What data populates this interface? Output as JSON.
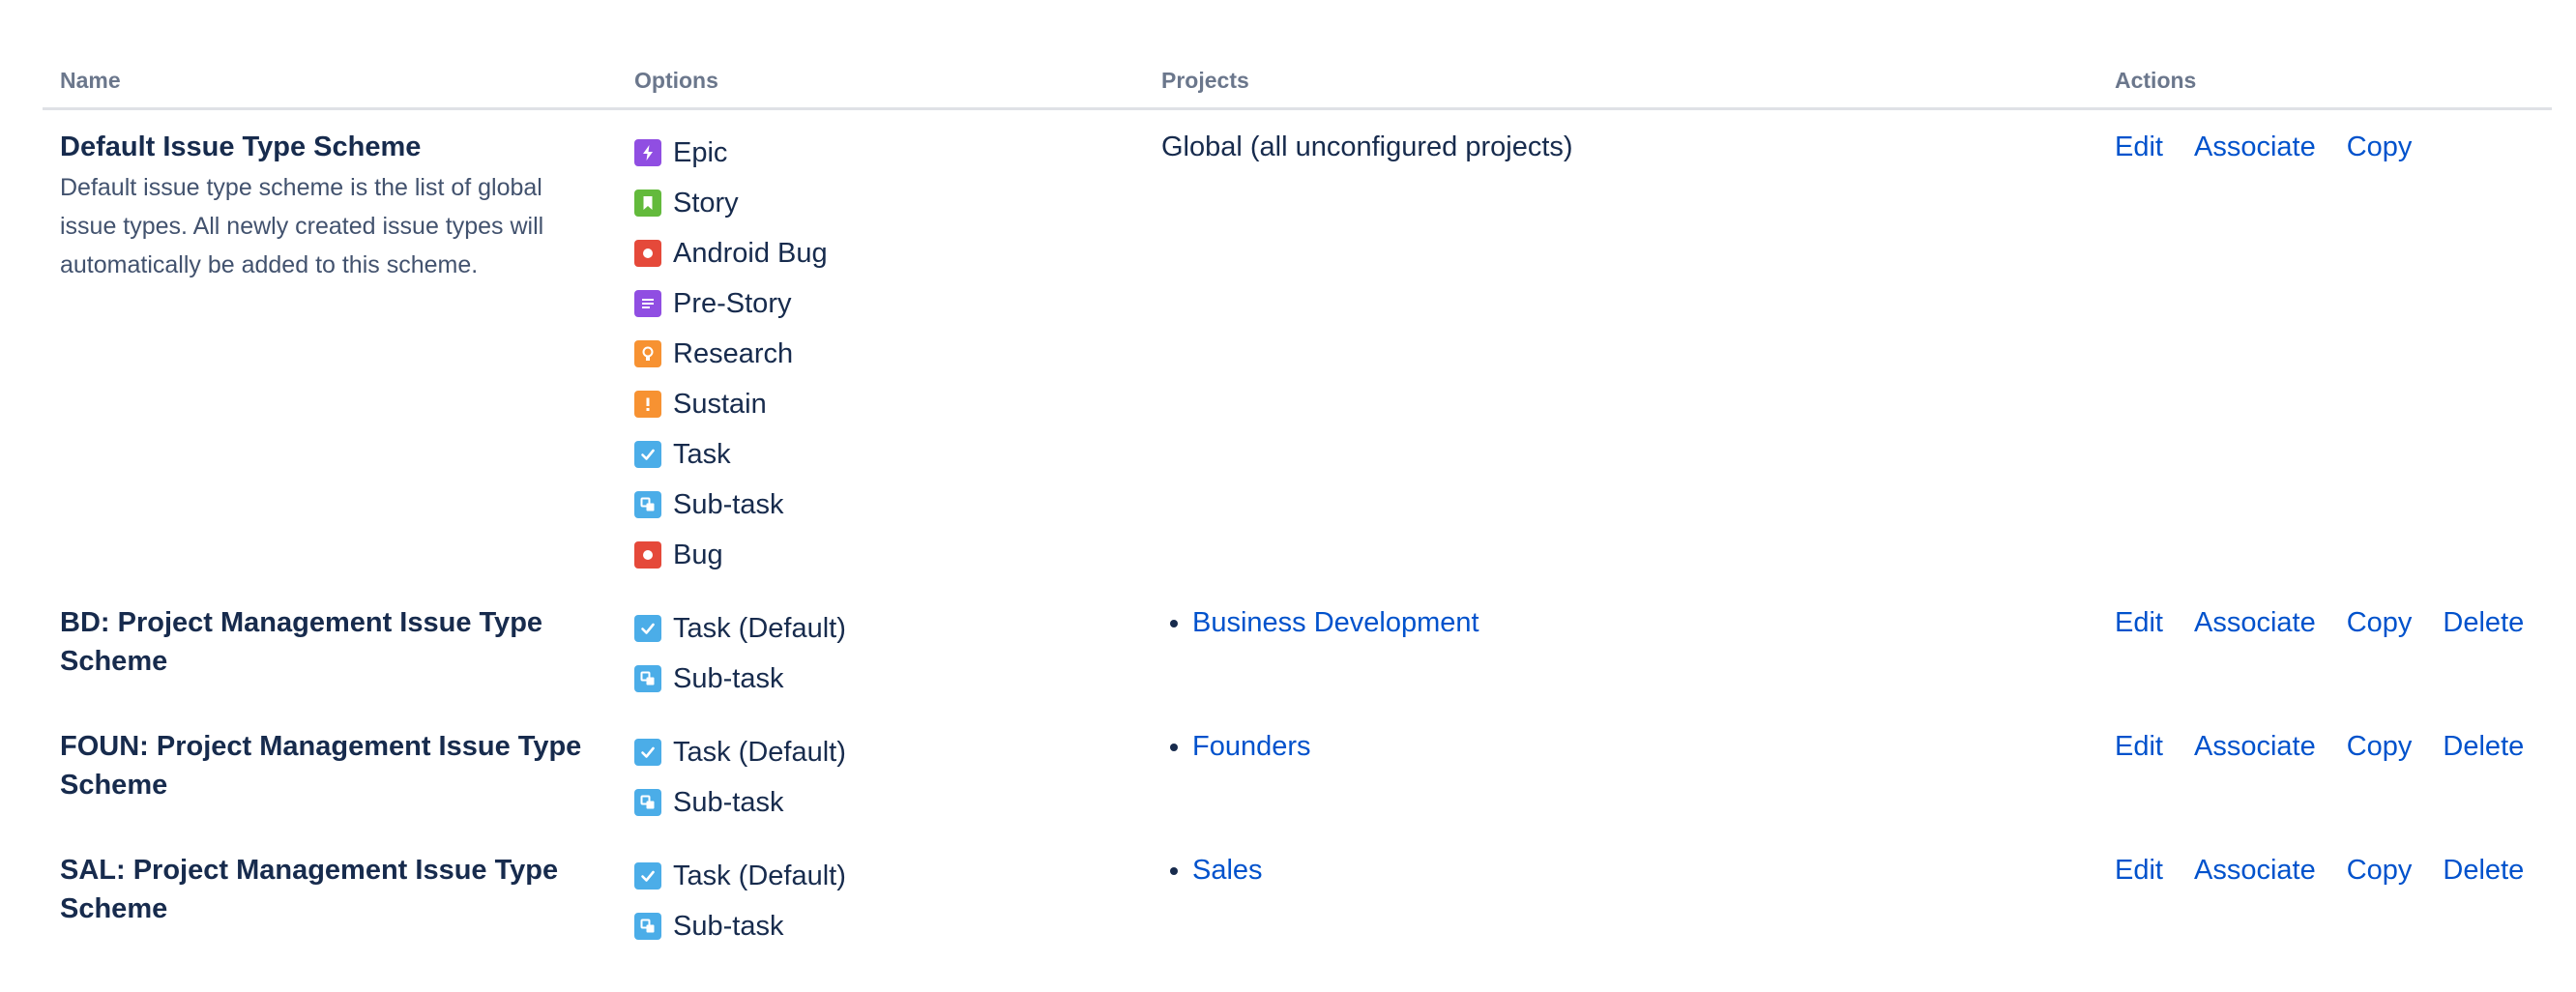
{
  "headers": {
    "name": "Name",
    "options": "Options",
    "projects": "Projects",
    "actions": "Actions"
  },
  "colors": {
    "link": "#0052CC",
    "text": "#172B4D",
    "muted": "#6B778C",
    "epic": "#904EE2",
    "story": "#63BA3C",
    "bug": "#E5493A",
    "prestory": "#904EE2",
    "research": "#F79232",
    "sustain": "#F79232",
    "task": "#4BADE8",
    "subtask": "#4BADE8"
  },
  "schemes": [
    {
      "name": "Default Issue Type Scheme",
      "description": "Default issue type scheme is the list of global issue types. All newly created issue types will automatically be added to this scheme.",
      "options": [
        {
          "label": "Epic",
          "icon": "epic-icon"
        },
        {
          "label": "Story",
          "icon": "story-icon"
        },
        {
          "label": "Android Bug",
          "icon": "bug-icon"
        },
        {
          "label": "Pre-Story",
          "icon": "prestory-icon"
        },
        {
          "label": "Research",
          "icon": "research-icon"
        },
        {
          "label": "Sustain",
          "icon": "sustain-icon"
        },
        {
          "label": "Task",
          "icon": "task-icon"
        },
        {
          "label": "Sub-task",
          "icon": "subtask-icon"
        },
        {
          "label": "Bug",
          "icon": "bug-icon"
        }
      ],
      "projects_text": "Global (all unconfigured projects)",
      "actions": {
        "edit": "Edit",
        "associate": "Associate",
        "copy": "Copy"
      }
    },
    {
      "name": "BD: Project Management Issue Type Scheme",
      "options": [
        {
          "label": "Task (Default)",
          "icon": "task-icon"
        },
        {
          "label": "Sub-task",
          "icon": "subtask-icon"
        }
      ],
      "project": "Business Development",
      "actions": {
        "edit": "Edit",
        "associate": "Associate",
        "copy": "Copy",
        "delete": "Delete"
      }
    },
    {
      "name": "FOUN: Project Management Issue Type Scheme",
      "options": [
        {
          "label": "Task (Default)",
          "icon": "task-icon"
        },
        {
          "label": "Sub-task",
          "icon": "subtask-icon"
        }
      ],
      "project": "Founders",
      "actions": {
        "edit": "Edit",
        "associate": "Associate",
        "copy": "Copy",
        "delete": "Delete"
      }
    },
    {
      "name": "SAL: Project Management Issue Type Scheme",
      "options": [
        {
          "label": "Task (Default)",
          "icon": "task-icon"
        },
        {
          "label": "Sub-task",
          "icon": "subtask-icon"
        }
      ],
      "project": "Sales",
      "actions": {
        "edit": "Edit",
        "associate": "Associate",
        "copy": "Copy",
        "delete": "Delete"
      }
    }
  ]
}
